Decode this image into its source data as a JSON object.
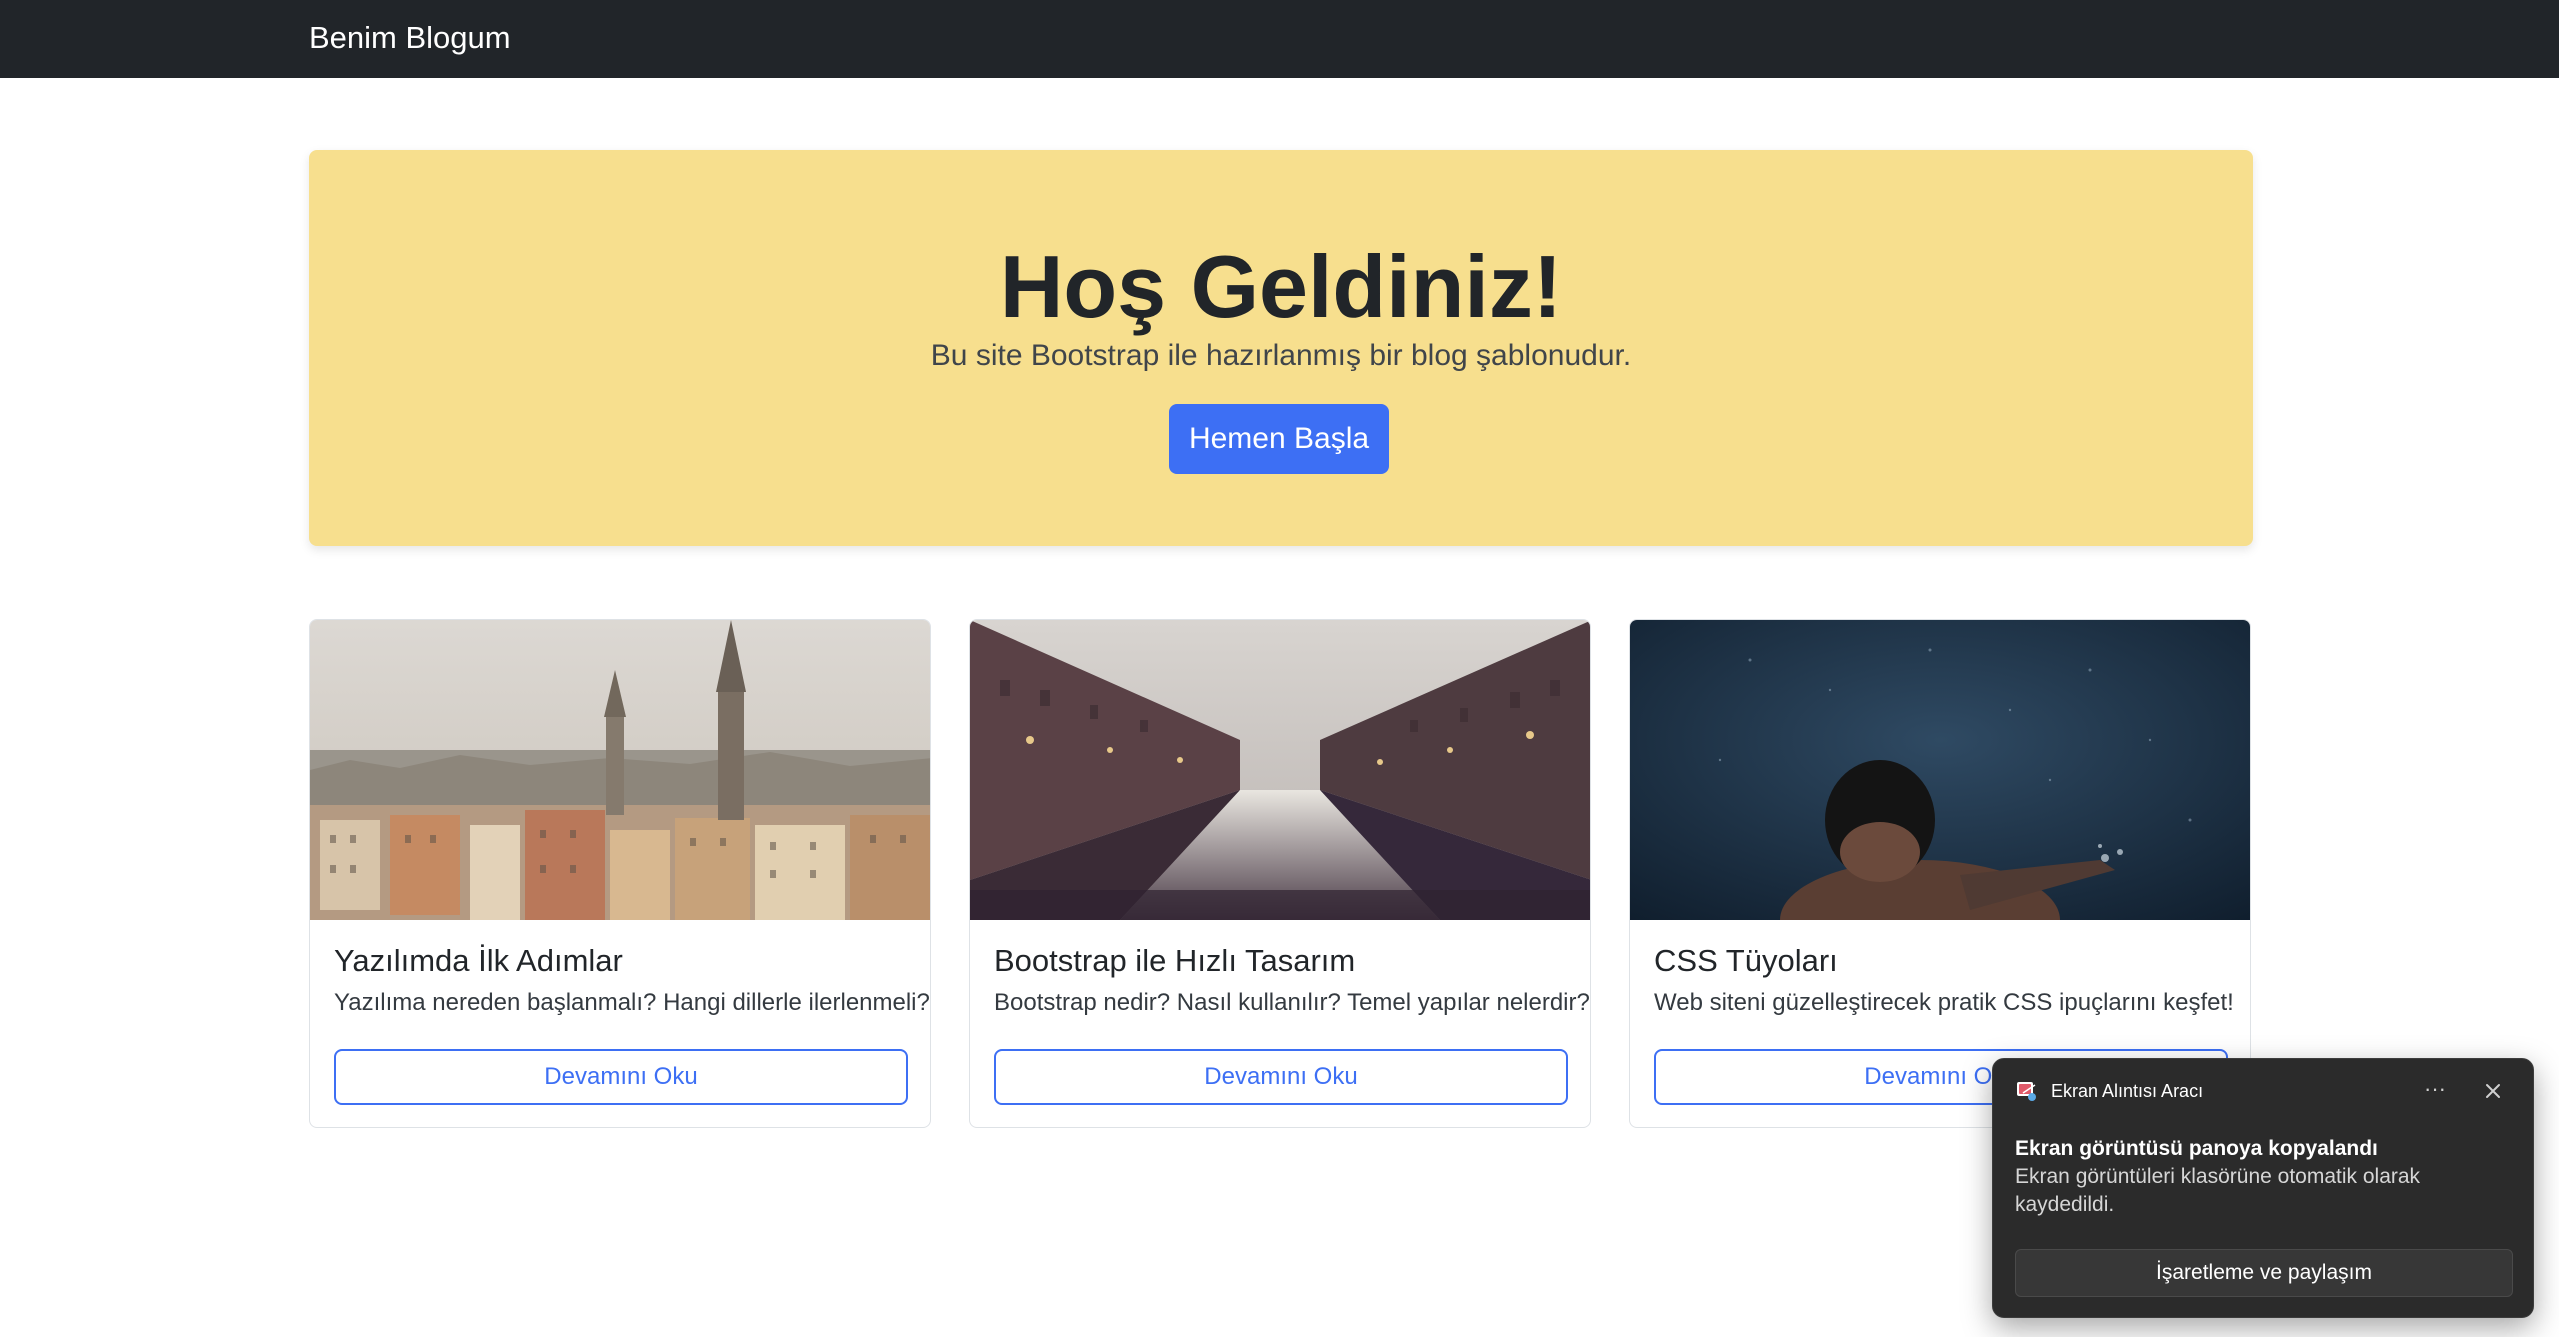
{
  "navbar": {
    "brand": "Benim Blogum"
  },
  "hero": {
    "title": "Hoş Geldiniz!",
    "subtitle": "Bu site Bootstrap ile hazırlanmış bir blog şablonudur.",
    "button_label": "Hemen Başla",
    "background_color": "#f7df8e",
    "button_color": "#3d6ff4"
  },
  "cards": [
    {
      "image": "city-skyline-image",
      "title": "Yazılımda İlk Adımlar",
      "text": "Yazılıma nereden başlanmalı? Hangi dillerle ilerlenmeli?",
      "button_label": "Devamını Oku"
    },
    {
      "image": "canal-street-image",
      "title": "Bootstrap ile Hızlı Tasarım",
      "text": "Bootstrap nedir? Nasıl kullanılır? Temel yapılar nelerdir?",
      "button_label": "Devamını Oku"
    },
    {
      "image": "underwater-swimmer-image",
      "title": "CSS Tüyoları",
      "text": "Web siteni güzelleştirecek pratik CSS ipuçlarını keşfet!",
      "button_label": "Devamını Oku"
    }
  ],
  "toast": {
    "app_name": "Ekran Alıntısı Aracı",
    "more_label": "···",
    "title": "Ekran görüntüsü panoya kopyalandı",
    "body": "Ekran görüntüleri klasörüne otomatik olarak kaydedildi.",
    "action_label": "İşaretleme ve paylaşım",
    "icons": [
      "snipping-tool-icon",
      "more-options-icon",
      "close-icon"
    ]
  },
  "colors": {
    "navbar": "#212529",
    "accent": "#3d6ff4",
    "toast_bg": "#2b2b2b"
  }
}
